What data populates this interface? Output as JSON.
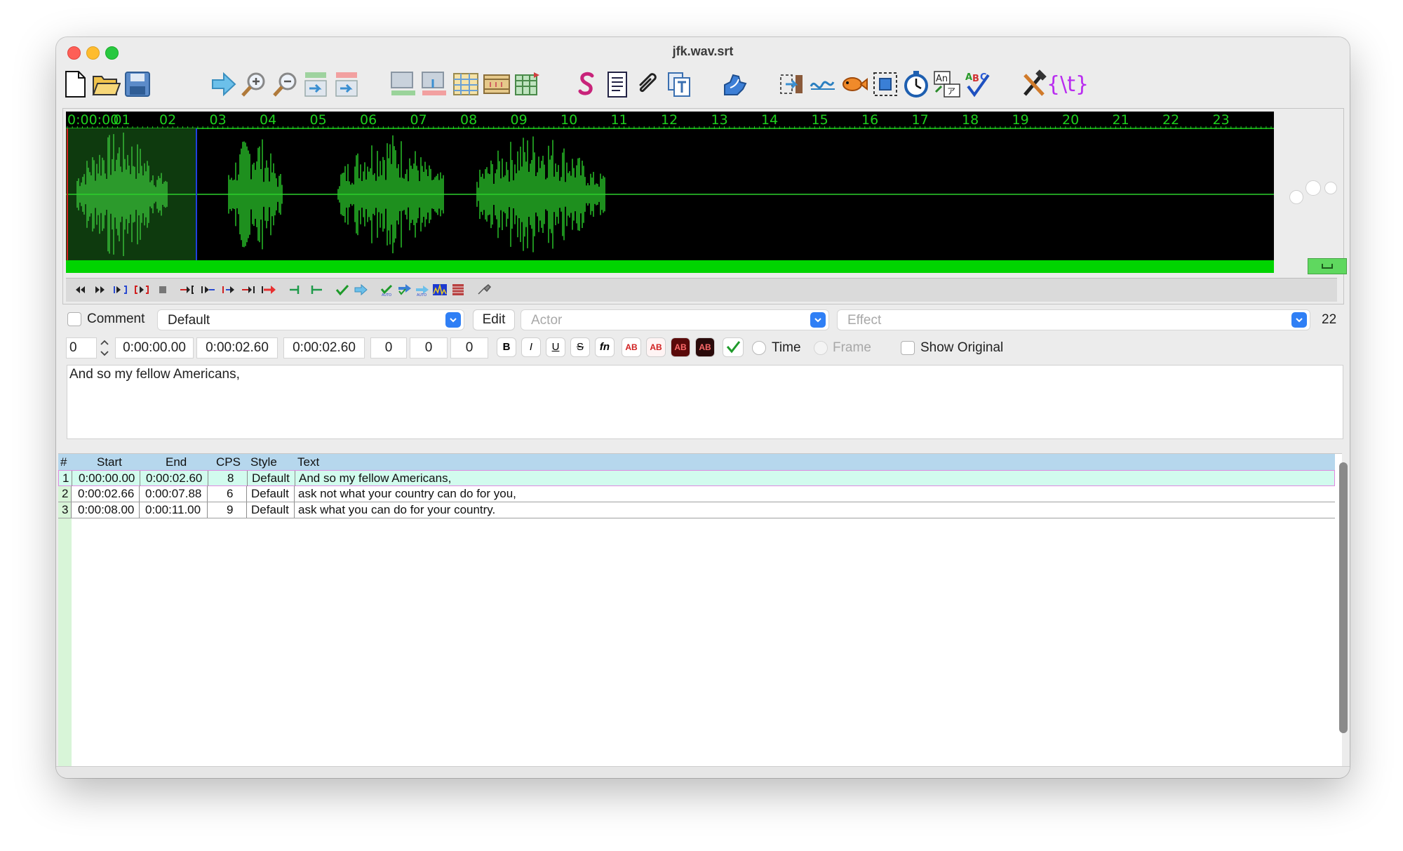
{
  "window": {
    "title": "jfk.wav.srt"
  },
  "toolbar": {
    "icons": [
      "new-file-icon",
      "open-folder-icon",
      "save-icon",
      "jump-arrow-icon",
      "zoom-in-icon",
      "zoom-out-icon",
      "snap-start-icon",
      "snap-end-icon",
      "video-frame-icon",
      "video-frame-2-icon",
      "grid-table-icon",
      "film-strip-icon",
      "grid-table-2-icon",
      "script-s-icon",
      "notepad-icon",
      "paperclip-icon",
      "translate-t-icon",
      "puzzle-icon",
      "shift-times-icon",
      "speed-squiggle-icon",
      "fish-icon",
      "selection-box-icon",
      "stopwatch-icon",
      "ab-dictionary-icon",
      "abc-spellcheck-icon",
      "tools-hammer-icon",
      "override-tag-icon"
    ],
    "override_tag_label": "{\\t}"
  },
  "audio": {
    "ruler_labels": [
      "0:00:00",
      "01",
      "02",
      "03",
      "04",
      "05",
      "06",
      "07",
      "08",
      "09",
      "10",
      "11",
      "12",
      "13",
      "14",
      "15",
      "16",
      "17",
      "18",
      "19",
      "20",
      "21",
      "22",
      "23"
    ],
    "waveform_color": "#1e8f1e",
    "selection_color": "#2c9a2c"
  },
  "editor": {
    "comment_label": "Comment",
    "style_value": "Default",
    "edit_button": "Edit",
    "actor_placeholder": "Actor",
    "effect_placeholder": "Effect",
    "char_count": "22",
    "layer": "0",
    "start_time": "0:00:00.00",
    "end_time": "0:00:02.60",
    "duration": "0:00:02.60",
    "margin_l": "0",
    "margin_r": "0",
    "margin_v": "0",
    "bold_label": "B",
    "italic_label": "I",
    "underline_label": "U",
    "strike_label": "S",
    "font_label": "fn",
    "color_label": "AB",
    "time_label": "Time",
    "frame_label": "Frame",
    "show_original_label": "Show Original",
    "text": "And so my fellow Americans,"
  },
  "grid": {
    "headers": [
      "#",
      "Start",
      "End",
      "CPS",
      "Style",
      "Text"
    ],
    "rows": [
      {
        "num": "1",
        "start": "0:00:00.00",
        "end": "0:00:02.60",
        "cps": "8",
        "style": "Default",
        "text": "And so my fellow Americans,"
      },
      {
        "num": "2",
        "start": "0:00:02.66",
        "end": "0:00:07.88",
        "cps": "6",
        "style": "Default",
        "text": "ask not what your country can do for you,"
      },
      {
        "num": "3",
        "start": "0:00:08.00",
        "end": "0:00:11.00",
        "cps": "9",
        "style": "Default",
        "text": "ask what you can do for your country."
      }
    ]
  }
}
